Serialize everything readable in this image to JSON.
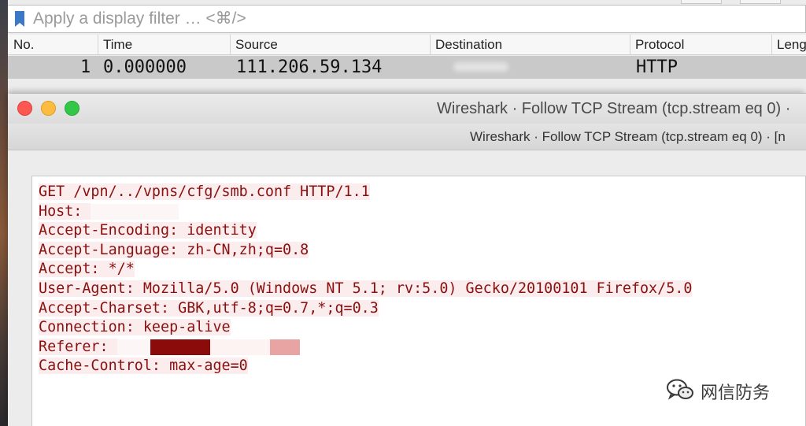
{
  "filter": {
    "placeholder": "Apply a display filter … <⌘/>"
  },
  "packet_list": {
    "columns": [
      "No.",
      "Time",
      "Source",
      "Destination",
      "Protocol",
      "Leng"
    ],
    "rows": [
      {
        "no": "1",
        "time": "0.000000",
        "source": "111.206.59.134",
        "destination": "",
        "protocol": "HTTP"
      }
    ]
  },
  "stream_window": {
    "title": "Wireshark · Follow TCP Stream (tcp.stream eq 0) ·",
    "subtitle": "Wireshark · Follow TCP Stream (tcp.stream eq 0) · [n",
    "lines": [
      "GET /vpn/../vpns/cfg/smb.conf HTTP/1.1",
      "Host: ",
      "Accept-Encoding: identity",
      "Accept-Language: zh-CN,zh;q=0.8",
      "Accept: */*",
      "User-Agent: Mozilla/5.0 (Windows NT 5.1; rv:5.0) Gecko/20100101 Firefox/5.0",
      "Accept-Charset: GBK,utf-8;q=0.7,*;q=0.3",
      "Connection: keep-alive",
      "Referer: ",
      "Cache-Control: max-age=0"
    ]
  },
  "watermark": {
    "text": "网信防务",
    "icon": "wechat-icon"
  },
  "colors": {
    "stream_text": "#8a1010",
    "stream_bg": "#fbeded",
    "selected_row": "#c9c9c9",
    "redaction_dark": "#8b0a0a",
    "redaction_light": "#e8a3a3"
  }
}
